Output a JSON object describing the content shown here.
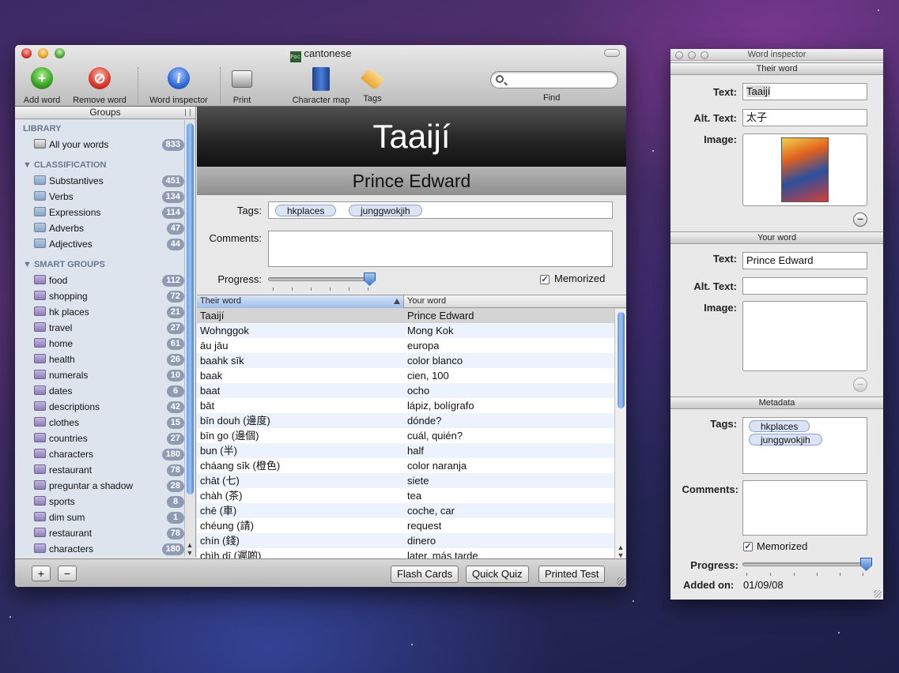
{
  "main_window": {
    "title": "cantonese",
    "doc_icon_text": "Poc",
    "toolbar": {
      "add_word": "Add word",
      "remove_word": "Remove word",
      "word_inspector": "Word inspector",
      "print": "Print",
      "character_map": "Character map",
      "tags": "Tags",
      "find": "Find",
      "search_value": ""
    }
  },
  "sidebar": {
    "header": "Groups",
    "library_title": "LIBRARY",
    "library": [
      {
        "label": "All your words",
        "count": "833"
      }
    ],
    "classification_title": "CLASSIFICATION",
    "classification": [
      {
        "label": "Substantives",
        "count": "451"
      },
      {
        "label": "Verbs",
        "count": "134"
      },
      {
        "label": "Expressions",
        "count": "114"
      },
      {
        "label": "Adverbs",
        "count": "47"
      },
      {
        "label": "Adjectives",
        "count": "44"
      }
    ],
    "smart_title": "SMART GROUPS",
    "smart": [
      {
        "label": "food",
        "count": "112"
      },
      {
        "label": "shopping",
        "count": "72"
      },
      {
        "label": "hk places",
        "count": "21"
      },
      {
        "label": "travel",
        "count": "27"
      },
      {
        "label": "home",
        "count": "61"
      },
      {
        "label": "health",
        "count": "26"
      },
      {
        "label": "numerals",
        "count": "10"
      },
      {
        "label": "dates",
        "count": "6"
      },
      {
        "label": "descriptions",
        "count": "42"
      },
      {
        "label": "clothes",
        "count": "15"
      },
      {
        "label": "countries",
        "count": "27"
      },
      {
        "label": "characters",
        "count": "180"
      },
      {
        "label": "restaurant",
        "count": "78"
      },
      {
        "label": "preguntar a shadow",
        "count": "28"
      },
      {
        "label": "sports",
        "count": "8"
      },
      {
        "label": "dim sum",
        "count": "1"
      },
      {
        "label": "restaurant",
        "count": "78"
      },
      {
        "label": "characters",
        "count": "180"
      }
    ]
  },
  "detail": {
    "word": "Taaijí",
    "translation": "Prince Edward",
    "tags_label": "Tags:",
    "tags": [
      "hkplaces",
      "junggwokjih"
    ],
    "comments_label": "Comments:",
    "progress_label": "Progress:",
    "progress": 1.0,
    "memorized_label": "Memorized",
    "memorized": true
  },
  "table": {
    "col_their": "Their word",
    "col_your": "Your word",
    "rows": [
      [
        "Taaijí",
        "Prince Edward"
      ],
      [
        "Wohnggok",
        "Mong Kok"
      ],
      [
        "āu jāu",
        "europa"
      ],
      [
        "baahk sīk",
        "color blanco"
      ],
      [
        "baak",
        "cien, 100"
      ],
      [
        "baat",
        "ocho"
      ],
      [
        "bāt",
        "lápiz, bolígrafo"
      ],
      [
        "bīn douh (邊度)",
        "dónde?"
      ],
      [
        "bīn go (邊個)",
        "cuál, quién?"
      ],
      [
        "bun (半)",
        "half"
      ],
      [
        "cháang sīk (橙色)",
        "color naranja"
      ],
      [
        "chāt (七)",
        "siete"
      ],
      [
        "chàh (茶)",
        "tea"
      ],
      [
        "chē (車)",
        "coche, car"
      ],
      [
        "chéung (請)",
        "request"
      ],
      [
        "chín (錢)",
        "dinero"
      ],
      [
        "chìh dī (遲啲)",
        "later, más tarde"
      ]
    ]
  },
  "bottom_bar": {
    "add": "+",
    "remove": "−",
    "flash_cards": "Flash Cards",
    "quick_quiz": "Quick Quiz",
    "printed_test": "Printed Test"
  },
  "inspector": {
    "title": "Word inspector",
    "their_section": "Their word",
    "text_label": "Text:",
    "alt_label": "Alt. Text:",
    "image_label": "Image:",
    "their_text": "Taaijí",
    "their_alt": "太子",
    "your_section": "Your word",
    "your_text": "Prince Edward",
    "your_alt": "",
    "metadata_section": "Metadata",
    "tags_label": "Tags:",
    "tags": [
      "hkplaces",
      "junggwokjih"
    ],
    "comments_label": "Comments:",
    "memorized_label": "Memorized",
    "progress_label": "Progress:",
    "progress": 1.0,
    "added_label": "Added on:",
    "added_value": "01/09/08"
  }
}
